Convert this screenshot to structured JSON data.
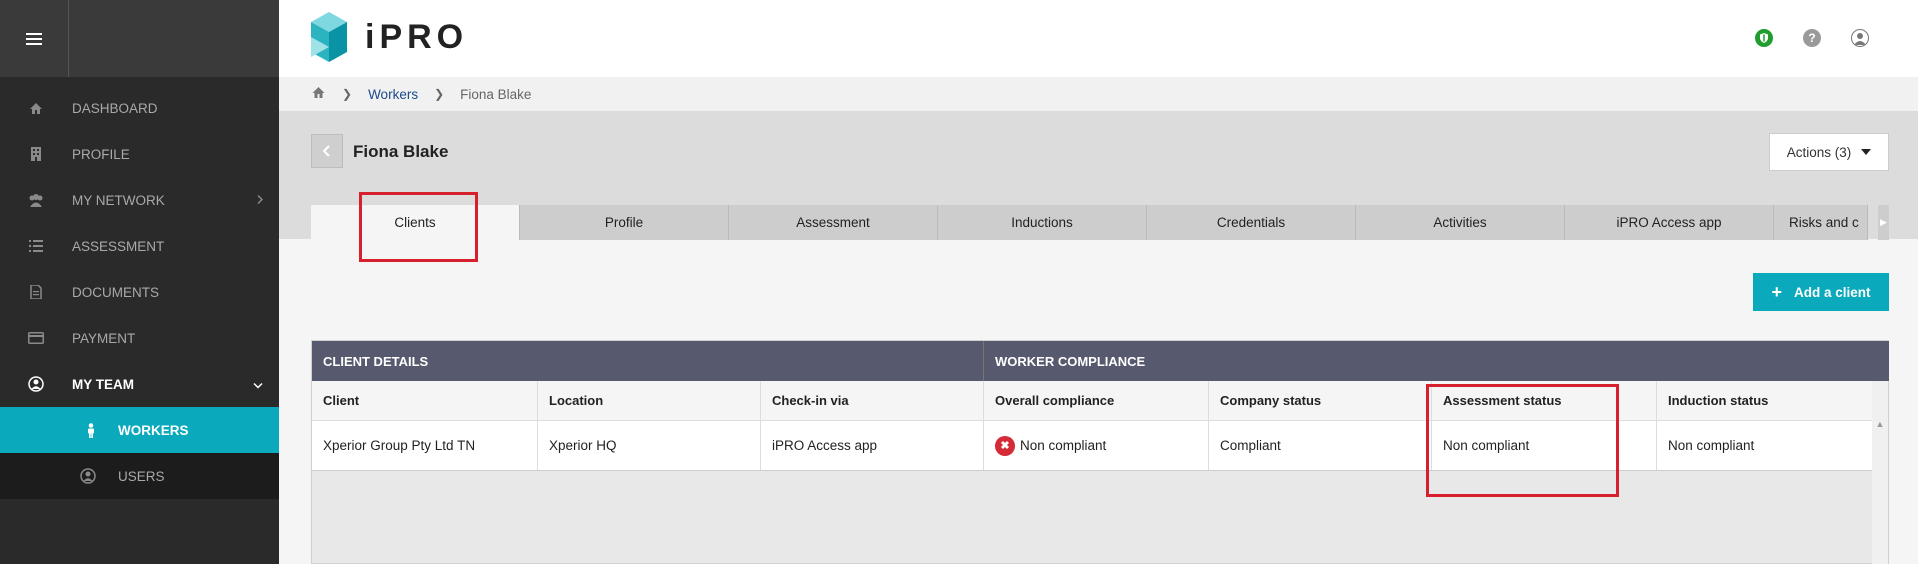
{
  "sidebar": {
    "items": [
      {
        "label": "DASHBOARD",
        "icon": "home-icon"
      },
      {
        "label": "PROFILE",
        "icon": "building-icon"
      },
      {
        "label": "MY NETWORK",
        "icon": "users-icon"
      },
      {
        "label": "ASSESSMENT",
        "icon": "list-icon"
      },
      {
        "label": "DOCUMENTS",
        "icon": "document-icon"
      },
      {
        "label": "PAYMENT",
        "icon": "credit-card-icon"
      },
      {
        "label": "MY TEAM",
        "icon": "user-circle-icon"
      }
    ],
    "subitems": [
      {
        "label": "WORKERS",
        "icon": "person-icon"
      },
      {
        "label": "USERS",
        "icon": "user-circle-icon"
      }
    ]
  },
  "header": {
    "logo_text": "iPRO"
  },
  "breadcrumb": {
    "workers": "Workers",
    "current": "Fiona Blake"
  },
  "page": {
    "title": "Fiona Blake",
    "actions_label": "Actions (3)",
    "add_client_label": "Add a client"
  },
  "tabs": [
    "Clients",
    "Profile",
    "Assessment",
    "Inductions",
    "Credentials",
    "Activities",
    "iPRO Access app",
    "Risks and c"
  ],
  "table": {
    "groups": {
      "client_details": "CLIENT DETAILS",
      "worker_compliance": "WORKER COMPLIANCE"
    },
    "columns": [
      "Client",
      "Location",
      "Check-in via",
      "Overall compliance",
      "Company status",
      "Assessment status",
      "Induction status"
    ],
    "rows": [
      [
        "Xperior Group Pty Ltd TN",
        "Xperior HQ",
        "iPRO Access app",
        "Non compliant",
        "Compliant",
        "Non compliant",
        "Non compliant"
      ]
    ]
  },
  "colors": {
    "accent": "#0aa9bb",
    "sidebar_bg": "#2a2a2a",
    "table_group_bg": "#575a6e",
    "error": "#d42b36",
    "highlight": "#d7202e"
  }
}
